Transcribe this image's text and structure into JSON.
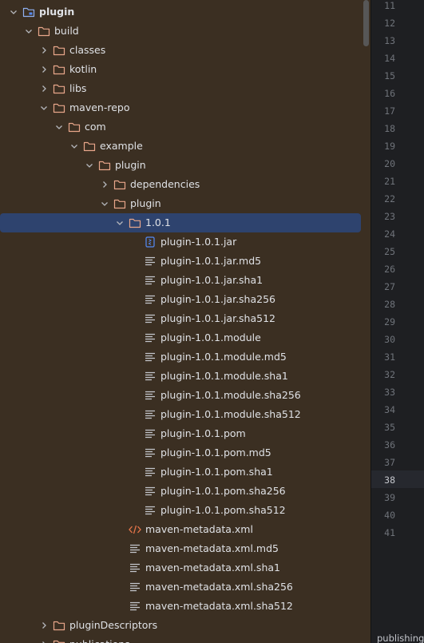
{
  "tree": [
    {
      "label": "plugin",
      "kind": "project-folder",
      "expanded": true,
      "bold": true,
      "depth": 0
    },
    {
      "label": "build",
      "kind": "folder",
      "expanded": true,
      "depth": 1
    },
    {
      "label": "classes",
      "kind": "folder",
      "expanded": false,
      "depth": 2
    },
    {
      "label": "kotlin",
      "kind": "folder",
      "expanded": false,
      "depth": 2
    },
    {
      "label": "libs",
      "kind": "folder",
      "expanded": false,
      "depth": 2
    },
    {
      "label": "maven-repo",
      "kind": "folder",
      "expanded": true,
      "depth": 2
    },
    {
      "label": "com",
      "kind": "folder",
      "expanded": true,
      "depth": 3
    },
    {
      "label": "example",
      "kind": "folder",
      "expanded": true,
      "depth": 4
    },
    {
      "label": "plugin",
      "kind": "folder",
      "expanded": true,
      "depth": 5
    },
    {
      "label": "dependencies",
      "kind": "folder",
      "expanded": false,
      "depth": 6
    },
    {
      "label": "plugin",
      "kind": "folder",
      "expanded": true,
      "depth": 6
    },
    {
      "label": "1.0.1",
      "kind": "folder",
      "expanded": true,
      "depth": 7,
      "selected": true
    },
    {
      "label": "plugin-1.0.1.jar",
      "kind": "jar",
      "depth": 8
    },
    {
      "label": "plugin-1.0.1.jar.md5",
      "kind": "text",
      "depth": 8
    },
    {
      "label": "plugin-1.0.1.jar.sha1",
      "kind": "text",
      "depth": 8
    },
    {
      "label": "plugin-1.0.1.jar.sha256",
      "kind": "text",
      "depth": 8
    },
    {
      "label": "plugin-1.0.1.jar.sha512",
      "kind": "text",
      "depth": 8
    },
    {
      "label": "plugin-1.0.1.module",
      "kind": "text",
      "depth": 8
    },
    {
      "label": "plugin-1.0.1.module.md5",
      "kind": "text",
      "depth": 8
    },
    {
      "label": "plugin-1.0.1.module.sha1",
      "kind": "text",
      "depth": 8
    },
    {
      "label": "plugin-1.0.1.module.sha256",
      "kind": "text",
      "depth": 8
    },
    {
      "label": "plugin-1.0.1.module.sha512",
      "kind": "text",
      "depth": 8
    },
    {
      "label": "plugin-1.0.1.pom",
      "kind": "text",
      "depth": 8
    },
    {
      "label": "plugin-1.0.1.pom.md5",
      "kind": "text",
      "depth": 8
    },
    {
      "label": "plugin-1.0.1.pom.sha1",
      "kind": "text",
      "depth": 8
    },
    {
      "label": "plugin-1.0.1.pom.sha256",
      "kind": "text",
      "depth": 8
    },
    {
      "label": "plugin-1.0.1.pom.sha512",
      "kind": "text",
      "depth": 8
    },
    {
      "label": "maven-metadata.xml",
      "kind": "xml",
      "depth": 7
    },
    {
      "label": "maven-metadata.xml.md5",
      "kind": "text",
      "depth": 7
    },
    {
      "label": "maven-metadata.xml.sha1",
      "kind": "text",
      "depth": 7
    },
    {
      "label": "maven-metadata.xml.sha256",
      "kind": "text",
      "depth": 7
    },
    {
      "label": "maven-metadata.xml.sha512",
      "kind": "text",
      "depth": 7
    },
    {
      "label": "pluginDescriptors",
      "kind": "folder",
      "expanded": false,
      "depth": 2
    },
    {
      "label": "publications",
      "kind": "folder",
      "expanded": false,
      "depth": 2
    }
  ],
  "line_numbers": [
    "11",
    "12",
    "13",
    "14",
    "15",
    "16",
    "17",
    "18",
    "19",
    "20",
    "21",
    "22",
    "23",
    "24",
    "25",
    "26",
    "27",
    "28",
    "29",
    "30",
    "31",
    "32",
    "33",
    "34",
    "35",
    "36",
    "37",
    "38",
    "39",
    "40",
    "41"
  ],
  "current_line": "38",
  "bottom_tab_label": "publishing",
  "colors": {
    "tree_bg": "#3b2f22",
    "selection": "#2e436e",
    "folder_stroke": "#e8a68a",
    "editor_bg": "#1e1f22",
    "xml_icon": "#e8754a",
    "jar_icon": "#548af7"
  }
}
